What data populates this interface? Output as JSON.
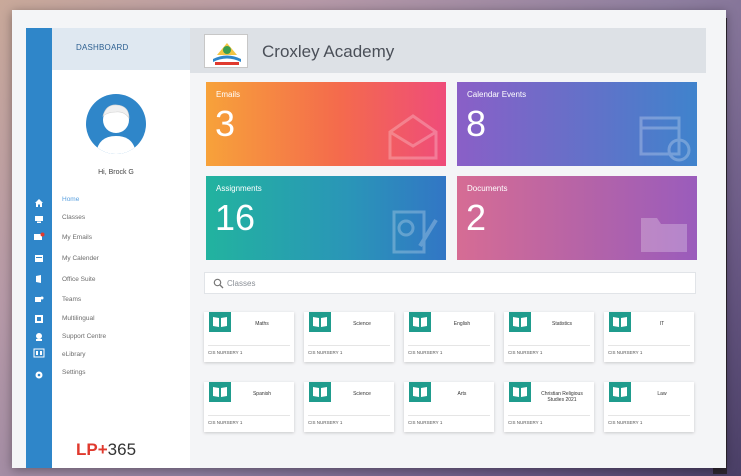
{
  "sidebar": {
    "header": "DASHBOARD",
    "greeting": "Hi, Brock G",
    "items": [
      {
        "label": "Home",
        "active": true,
        "icon": "home-icon"
      },
      {
        "label": "Classes",
        "active": false,
        "icon": "classes-icon"
      },
      {
        "label": "My Emails",
        "active": false,
        "icon": "mail-icon"
      },
      {
        "label": "My Calender",
        "active": false,
        "icon": "calendar-icon"
      },
      {
        "label": "Office Suite",
        "active": false,
        "icon": "office-icon"
      },
      {
        "label": "Teams",
        "active": false,
        "icon": "teams-icon"
      },
      {
        "label": "Multilingual",
        "active": false,
        "icon": "language-icon"
      },
      {
        "label": "Support Centre",
        "active": false,
        "icon": "support-icon"
      },
      {
        "label": "eLibrary",
        "active": false,
        "icon": "library-icon"
      },
      {
        "label": "Settings",
        "active": false,
        "icon": "gear-icon"
      }
    ],
    "logo_prefix": "LP+",
    "logo_suffix": "365"
  },
  "header": {
    "school_name": "Croxley Academy"
  },
  "tiles": [
    {
      "label": "Emails",
      "count": "3",
      "icon": "envelope-icon"
    },
    {
      "label": "Calendar Events",
      "count": "8",
      "icon": "calendar-icon"
    },
    {
      "label": "Assignments",
      "count": "16",
      "icon": "assignment-icon"
    },
    {
      "label": "Documents",
      "count": "2",
      "icon": "folder-icon"
    }
  ],
  "search": {
    "placeholder": "Classes"
  },
  "classes": [
    {
      "name": "Maths",
      "group": "CIS NURSERY 1"
    },
    {
      "name": "Science",
      "group": "CIS NURSERY 1"
    },
    {
      "name": "English",
      "group": "CIS NURSERY 1"
    },
    {
      "name": "Statistics",
      "group": "CIS NURSERY 1"
    },
    {
      "name": "IT",
      "group": "CIS NURSERY 1"
    },
    {
      "name": "Spanish",
      "group": "CIS NURSERY 1"
    },
    {
      "name": "Science",
      "group": "CIS NURSERY 1"
    },
    {
      "name": "Arts",
      "group": "CIS NURSERY 1"
    },
    {
      "name": "Christian Religious Studies 2021",
      "group": "CIS NURSERY 1"
    },
    {
      "name": "Law",
      "group": "CIS NURSERY 1"
    }
  ],
  "colors": {
    "rail": "#2f86c9",
    "accent_teal": "#1f9c8d",
    "brand_red": "#e03a2e"
  }
}
